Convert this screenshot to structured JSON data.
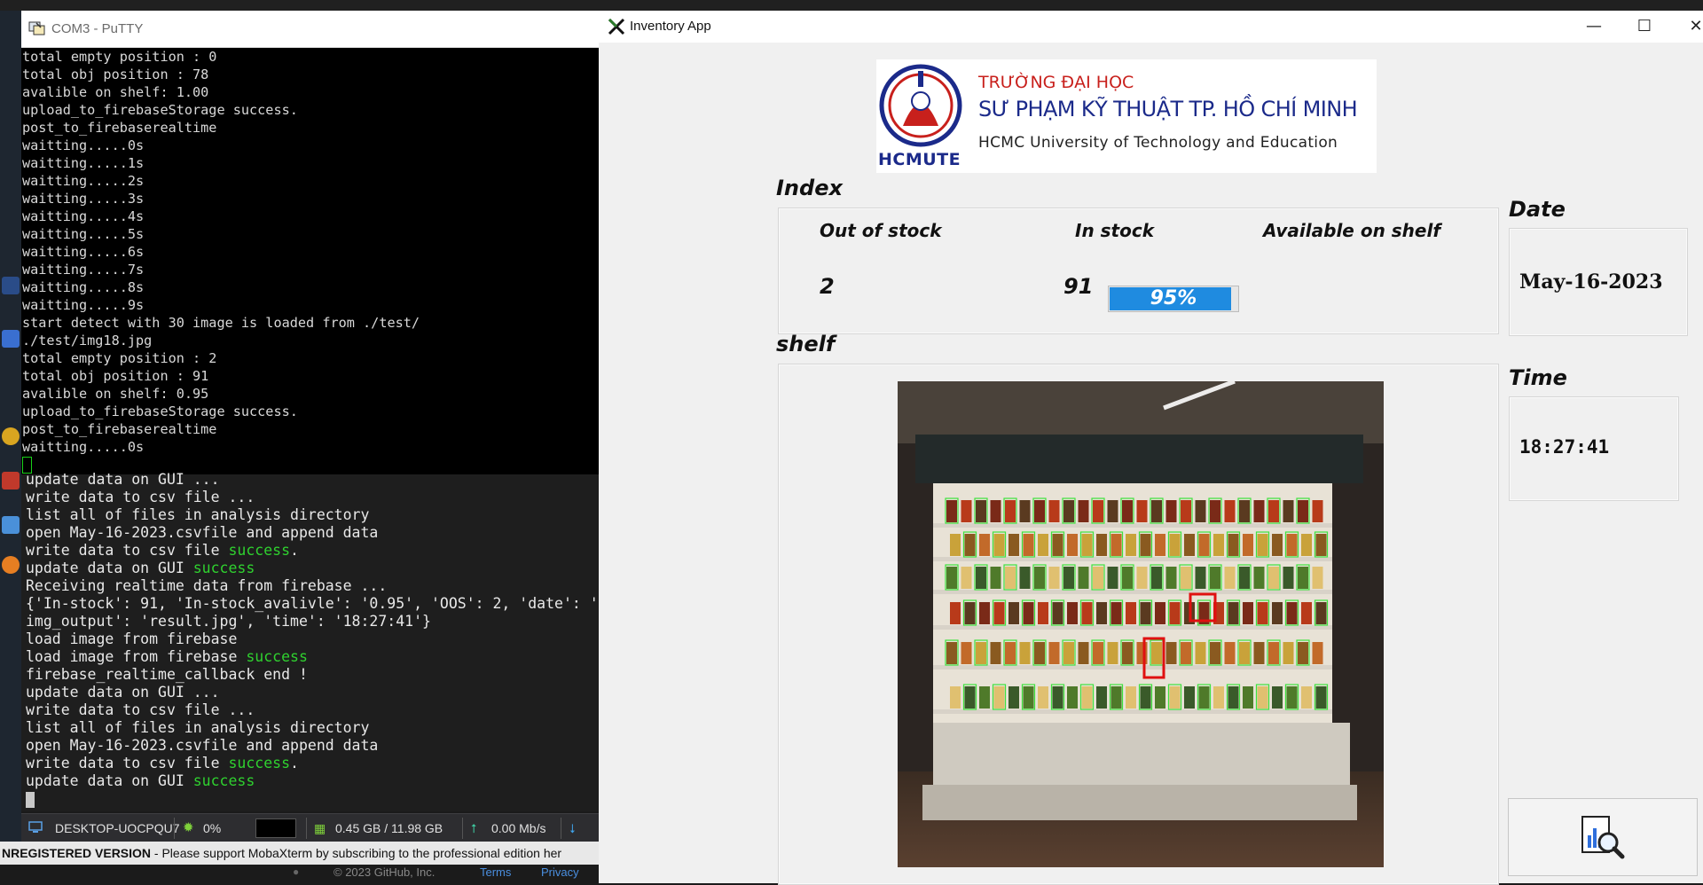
{
  "putty": {
    "title": "COM3 - PuTTY",
    "lines": [
      "total empty position : 0",
      "total obj position : 78",
      "avalible on shelf: 1.00",
      "upload_to_firebaseStorage success.",
      "post_to_firebaserealtime",
      "waitting.....0s",
      "waitting.....1s",
      "waitting.....2s",
      "waitting.....3s",
      "waitting.....4s",
      "waitting.....5s",
      "waitting.....6s",
      "waitting.....7s",
      "waitting.....8s",
      "waitting.....9s",
      "start detect with 30 image is loaded from ./test/",
      "./test/img18.jpg",
      "total empty position : 2",
      "total obj position : 91",
      "avalible on shelf: 0.95",
      "upload_to_firebaseStorage success.",
      "post_to_firebaserealtime",
      "waitting.....0s"
    ]
  },
  "terminal": {
    "lines": [
      {
        "text": "update data on GUI ...",
        "ok": ""
      },
      {
        "text": "write data to csv file ...",
        "ok": ""
      },
      {
        "text": "list all of files in analysis directory",
        "ok": ""
      },
      {
        "text": "open May-16-2023.csvfile and append data",
        "ok": ""
      },
      {
        "text": "write data to csv file ",
        "ok": "success",
        "tail": "."
      },
      {
        "text": "update data on GUI ",
        "ok": "success",
        "tail": ""
      },
      {
        "text": "Receiving realtime data from firebase ...",
        "ok": ""
      },
      {
        "text": "{'In-stock': 91, 'In-stock_avalivle': '0.95', 'OOS': 2, 'date': '",
        "ok": ""
      },
      {
        "text": "img_output': 'result.jpg', 'time': '18:27:41'}",
        "ok": ""
      },
      {
        "text": "load image from firebase",
        "ok": ""
      },
      {
        "text": "load image from firebase ",
        "ok": "success",
        "tail": ""
      },
      {
        "text": "firebase_realtime_callback end !",
        "ok": ""
      },
      {
        "text": "update data on GUI ...",
        "ok": ""
      },
      {
        "text": "write data to csv file ...",
        "ok": ""
      },
      {
        "text": "list all of files in analysis directory",
        "ok": ""
      },
      {
        "text": "open May-16-2023.csvfile and append data",
        "ok": ""
      },
      {
        "text": "write data to csv file ",
        "ok": "success",
        "tail": "."
      },
      {
        "text": "update data on GUI ",
        "ok": "success",
        "tail": ""
      }
    ]
  },
  "statusbar": {
    "host": "DESKTOP-UOCPQU7",
    "cpu": "0%",
    "memory": "0.45 GB / 11.98 GB",
    "network": "0.00 Mb/s"
  },
  "unregistered": {
    "bold": "NREGISTERED VERSION",
    "text": "  -  Please support MobaXterm by subscribing to the professional edition her"
  },
  "footer": {
    "copyright": "© 2023 GitHub, Inc.",
    "terms": "Terms",
    "privacy": "Privacy"
  },
  "app": {
    "title": "Inventory App",
    "banner": {
      "line1": "TRƯỜNG ĐẠI HỌC",
      "line2": "SƯ PHẠM KỸ THUẬT TP. HỒ CHÍ MINH",
      "line3": "HCMC University of Technology and Education",
      "logo_text": "HCMUTE"
    },
    "index": {
      "label": "Index",
      "out_of_stock_label": "Out of stock",
      "in_stock_label": "In stock",
      "available_label": "Available on shelf",
      "out_of_stock": "2",
      "in_stock": "91",
      "available_text": "95%",
      "available_fraction": 0.95
    },
    "shelf_label": "shelf",
    "date": {
      "label": "Date",
      "value": "May-16-2023"
    },
    "time": {
      "label": "Time",
      "value": "18:27:41"
    },
    "analyze_icon": "chart-magnifier-icon"
  },
  "colors": {
    "success": "#2fd12f",
    "progress": "#1f8be0",
    "detect_ok": "#3ee23e",
    "detect_empty": "#e01010"
  }
}
